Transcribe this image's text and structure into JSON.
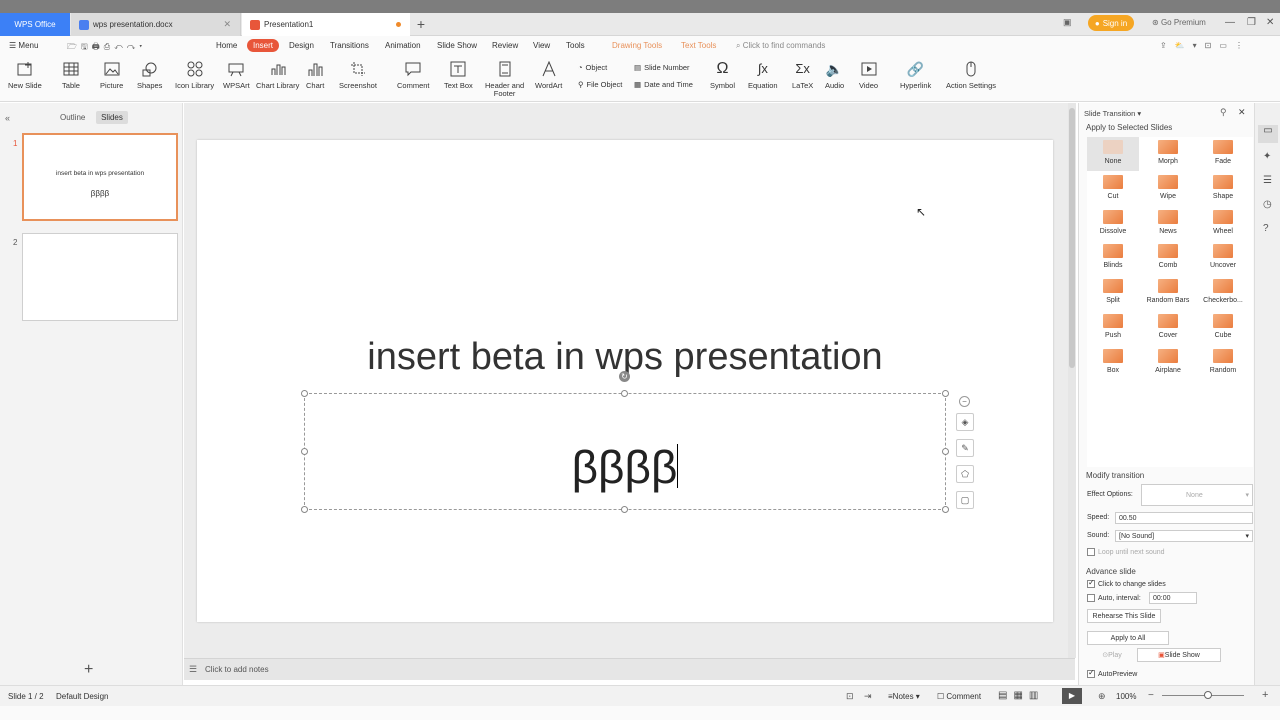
{
  "tabs": {
    "wps": "WPS Office",
    "doc": "wps presentation.docx",
    "ppt": "Presentation1"
  },
  "account": {
    "signin": "Sign in",
    "premium": "Go Premium"
  },
  "menu": {
    "menu": "Menu",
    "search_placeholder": "Click to find commands",
    "items": [
      "Home",
      "Insert",
      "Design",
      "Transitions",
      "Animation",
      "Slide Show",
      "Review",
      "View",
      "Tools",
      "Drawing Tools",
      "Text Tools"
    ]
  },
  "ribbon": {
    "new_slide": "New Slide",
    "table": "Table",
    "picture": "Picture",
    "shapes": "Shapes",
    "icon_library": "Icon Library",
    "wpsart": "WPSArt",
    "chart_library": "Chart Library",
    "chart": "Chart",
    "screenshot": "Screenshot",
    "comment": "Comment",
    "text_box": "Text Box",
    "header_footer_1": "Header and",
    "header_footer_2": "Footer",
    "wordart": "WordArt",
    "object": "Object",
    "file_object": "File Object",
    "slide_number": "Slide Number",
    "date_time": "Date and Time",
    "symbol": "Symbol",
    "equation": "Equation",
    "latex": "LaTeX",
    "audio": "Audio",
    "video": "Video",
    "hyperlink": "Hyperlink",
    "action_settings": "Action Settings"
  },
  "left_panel": {
    "outline": "Outline",
    "slides": "Slides",
    "thumbs": [
      {
        "num": "1",
        "title": "insert beta in wps presentation",
        "sub": "ββββ"
      },
      {
        "num": "2",
        "title": "",
        "sub": ""
      }
    ]
  },
  "slide": {
    "title": "insert beta in wps presentation",
    "body": "ββββ"
  },
  "notes": {
    "placeholder": "Click to add notes"
  },
  "transition_panel": {
    "header": "Slide Transition",
    "apply_selected": "Apply to Selected Slides",
    "effects": [
      "None",
      "Morph",
      "Fade",
      "Cut",
      "Wipe",
      "Shape",
      "Dissolve",
      "News",
      "Wheel",
      "Blinds",
      "Comb",
      "Uncover",
      "Split",
      "Random Bars",
      "Checkerbo...",
      "Push",
      "Cover",
      "Cube",
      "Box",
      "Airplane",
      "Random"
    ],
    "modify": "Modify transition",
    "effect_options_label": "Effect Options:",
    "effect_options_value": "None",
    "speed_label": "Speed:",
    "speed_value": "00.50",
    "sound_label": "Sound:",
    "sound_value": "[No Sound]",
    "loop": "Loop until next sound",
    "advance": "Advance slide",
    "click_change": "Click to change slides",
    "auto_interval": "Auto, interval:",
    "interval_value": "00:00",
    "rehearse": "Rehearse This Slide",
    "apply_all": "Apply to All",
    "play": "Play",
    "slide_show": "Slide Show",
    "autopreview": "AutoPreview"
  },
  "status": {
    "slide_count": "Slide 1 / 2",
    "design": "Default Design",
    "notes": "Notes",
    "comment": "Comment",
    "zoom": "100%"
  },
  "colors": {
    "accent": "#e8563a",
    "wps_blue": "#3c80f6",
    "transition_orange": "#ea7d3f",
    "slide_border": "#e8915a"
  }
}
